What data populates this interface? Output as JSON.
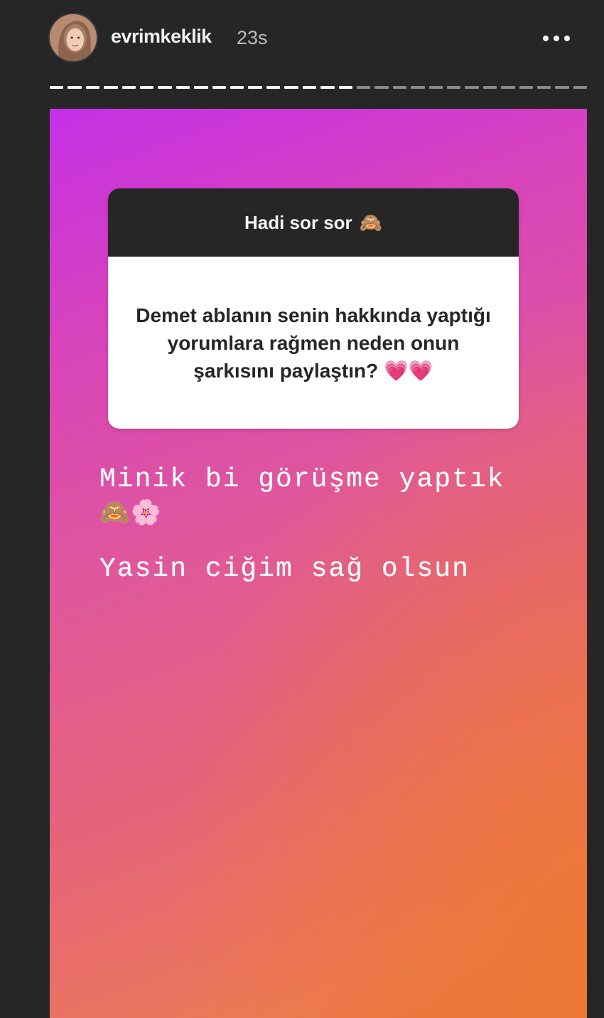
{
  "header": {
    "username": "evrimkeklik",
    "time_ago": "23s",
    "more_icon": "more-horizontal-icon"
  },
  "progress": {
    "segments_total": 30,
    "segments_viewed": 17
  },
  "story": {
    "question_sticker": {
      "title": "Hadi sor sor",
      "title_emoji": "🙈",
      "question": "Demet ablanın senin hakkında yaptığı yorumlara rağmen neden onun şarkısını paylaştın? 💗💗"
    },
    "reply_lines": [
      "Minik bi görüşme yaptık",
      "🙈🌸",
      "Yasin ciğim sağ olsun"
    ]
  },
  "colors": {
    "gradient_top": "#c530e6",
    "gradient_mid": "#e0589a",
    "gradient_bottom": "#ec7a58",
    "background": "#262626"
  }
}
